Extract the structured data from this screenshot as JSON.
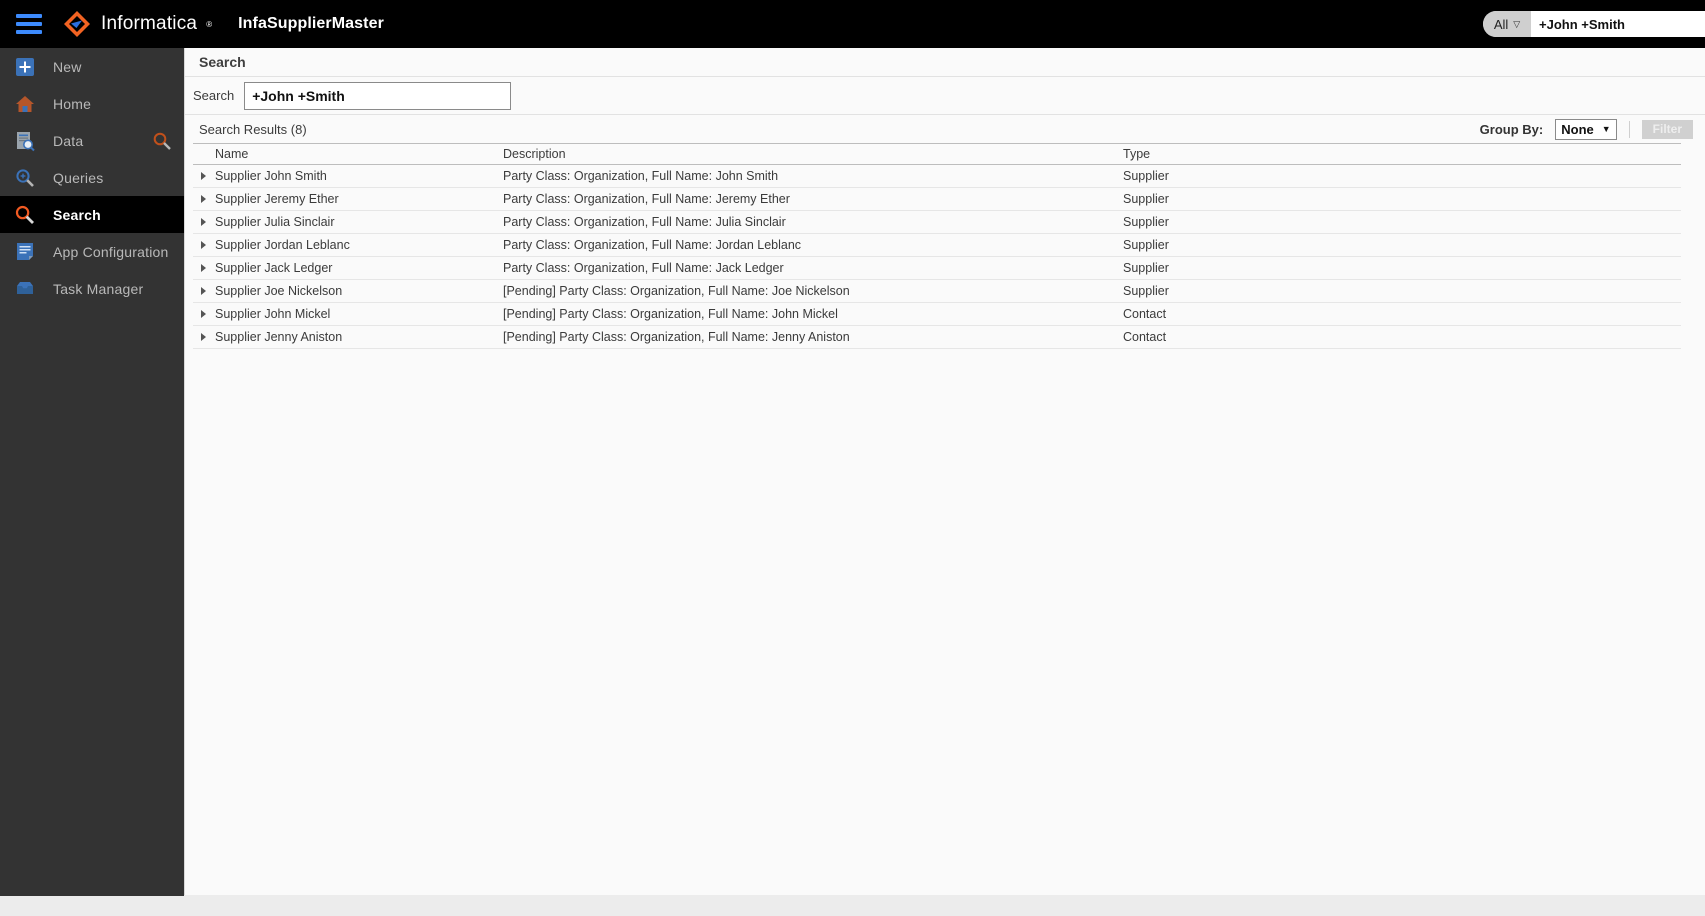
{
  "topbar": {
    "menu_icon": "hamburger-icon",
    "brand": "Informatica",
    "brand_registered": "®",
    "app_title": "InfaSupplierMaster",
    "global_search": {
      "scope": "All",
      "scope_caret": "▽",
      "value": "+John +Smith"
    }
  },
  "sidebar": {
    "items": [
      {
        "label": "New",
        "icon": "plus-square-icon",
        "active": false,
        "trailing_icon": ""
      },
      {
        "label": "Home",
        "icon": "home-icon",
        "active": false,
        "trailing_icon": ""
      },
      {
        "label": "Data",
        "icon": "data-search-icon",
        "active": false,
        "trailing_icon": "search-icon"
      },
      {
        "label": "Queries",
        "icon": "query-magnifier-icon",
        "active": false,
        "trailing_icon": ""
      },
      {
        "label": "Search",
        "icon": "search-icon",
        "active": true,
        "trailing_icon": ""
      },
      {
        "label": "App Configuration",
        "icon": "document-config-icon",
        "active": false,
        "trailing_icon": ""
      },
      {
        "label": "Task Manager",
        "icon": "tray-icon",
        "active": false,
        "trailing_icon": ""
      }
    ]
  },
  "page": {
    "title": "Search",
    "search_label": "Search",
    "search_value": "+John +Smith",
    "search_placeholder": "",
    "results_label": "Search Results (8)",
    "group_by_label": "Group By:",
    "group_by_value": "None",
    "group_by_caret": "▼",
    "filter_label": "Filter"
  },
  "table": {
    "columns": [
      "Name",
      "Description",
      "Type"
    ],
    "rows": [
      {
        "name": "Supplier John Smith",
        "description": "Party Class: Organization, Full Name: John Smith",
        "type": "Supplier"
      },
      {
        "name": "Supplier Jeremy Ether",
        "description": "Party Class: Organization, Full Name: Jeremy Ether",
        "type": "Supplier"
      },
      {
        "name": "Supplier Julia Sinclair",
        "description": "Party Class: Organization, Full Name: Julia Sinclair",
        "type": "Supplier"
      },
      {
        "name": "Supplier Jordan Leblanc",
        "description": "Party Class: Organization, Full Name: Jordan Leblanc",
        "type": "Supplier"
      },
      {
        "name": "Supplier Jack Ledger",
        "description": "Party Class: Organization, Full Name: Jack Ledger",
        "type": "Supplier"
      },
      {
        "name": "Supplier Joe Nickelson",
        "description": "[Pending] Party Class: Organization, Full Name: Joe Nickelson",
        "type": "Supplier"
      },
      {
        "name": "Supplier John Mickel",
        "description": "[Pending] Party Class: Organization, Full Name: John Mickel",
        "type": "Contact"
      },
      {
        "name": "Supplier Jenny Aniston",
        "description": "[Pending] Party Class: Organization, Full Name: Jenny Aniston",
        "type": "Contact"
      }
    ]
  },
  "colors": {
    "brand_orange": "#f26322",
    "accent_blue": "#3d8bfd",
    "sidebar_bg": "#333333",
    "topbar_bg": "#000000",
    "content_bg": "#fafafa"
  }
}
